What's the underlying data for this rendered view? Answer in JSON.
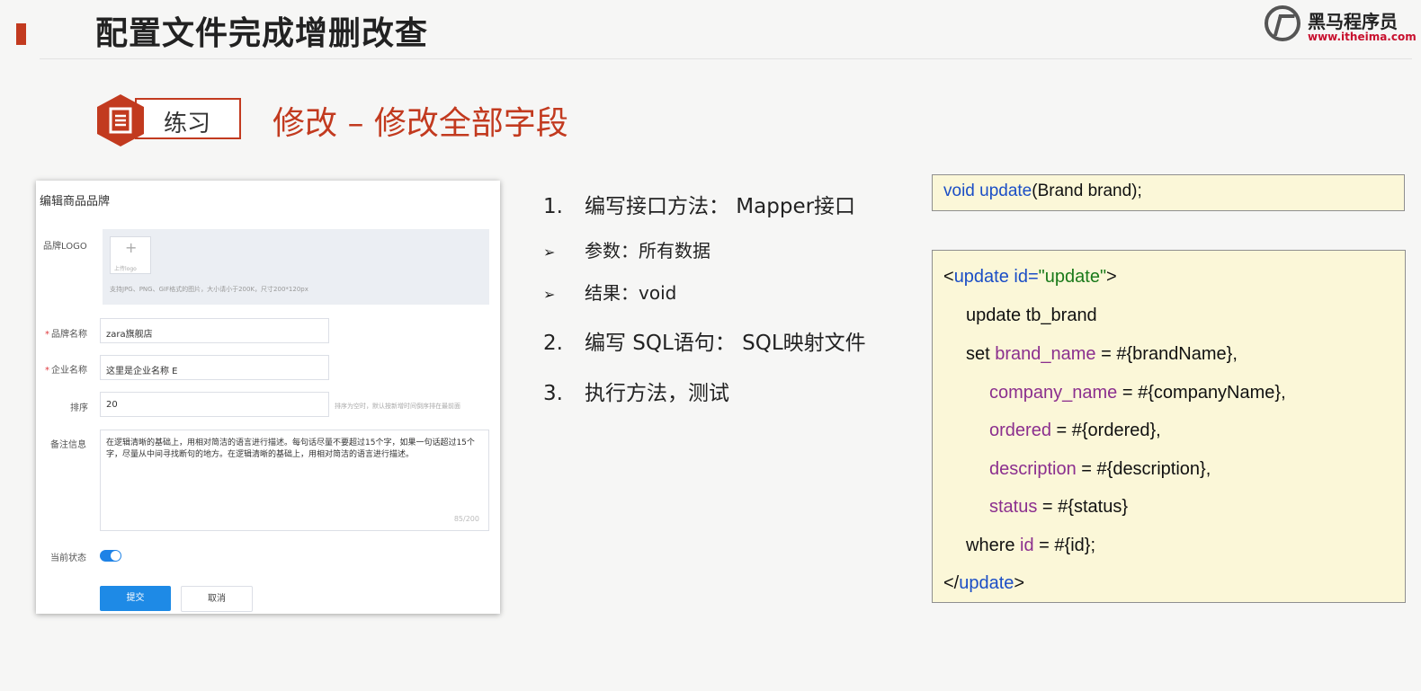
{
  "header": {
    "title": "配置文件完成增删改查",
    "brand_name": "黑马程序员",
    "brand_url": "www.itheima.com"
  },
  "badge": {
    "label": "练习",
    "section_title": "修改 – 修改全部字段"
  },
  "form": {
    "title": "编辑商品品牌",
    "logo_label": "品牌LOGO",
    "upload_text": "上传logo",
    "upload_tip": "支持JPG、PNG、GIF格式的图片，大小请小于200K，尺寸200*120px",
    "brand_name_label": "品牌名称",
    "brand_name_value": "zara旗舰店",
    "company_label": "企业名称",
    "company_value": "这里是企业名称 E",
    "order_label": "排序",
    "order_value": "20",
    "order_hint": "排序为空时，默认按新增时间倒序排在最前面",
    "remark_label": "备注信息",
    "remark_value": "在逻辑清晰的基础上，用相对简洁的语言进行描述。每句话尽量不要超过15个字，如果一句话超过15个字，尽量从中间寻找断句的地方。在逻辑清晰的基础上，用相对简洁的语言进行描述。",
    "remark_count": "85/200",
    "status_label": "当前状态",
    "status_on": true,
    "submit_label": "提交",
    "cancel_label": "取消"
  },
  "steps": [
    {
      "num": "1.",
      "text": "编写接口方法： Mapper接口"
    },
    {
      "num": "➢",
      "text": "参数：所有数据"
    },
    {
      "num": "➢",
      "text": "结果：void"
    },
    {
      "num": "2.",
      "text": "编写 SQL语句： SQL映射文件"
    },
    {
      "num": "3.",
      "text": "执行方法，测试"
    }
  ],
  "code": {
    "sig_void": "void",
    "sig_update": "update",
    "sig_rest": "(Brand brand);",
    "xml_open_lt": "<",
    "xml_tag": "update",
    "xml_attr": "id=",
    "xml_attr_val": "\"update\"",
    "xml_open_gt": ">",
    "l_update": "update tb_brand",
    "l_set": "set ",
    "c_brand_name": "brand_name",
    "v_brand_name": " = #{brandName},",
    "c_company_name": "company_name",
    "v_company_name": " = #{companyName},",
    "c_ordered": "ordered",
    "v_ordered": " = #{ordered},",
    "c_description": "description",
    "v_description": " = #{description},",
    "c_status": "status",
    "v_status": " = #{status}",
    "l_where": "where ",
    "c_id": "id",
    "v_id": " = #{id};",
    "xml_close_lt": "</",
    "xml_close_tag": "update",
    "xml_close_gt": ">"
  }
}
